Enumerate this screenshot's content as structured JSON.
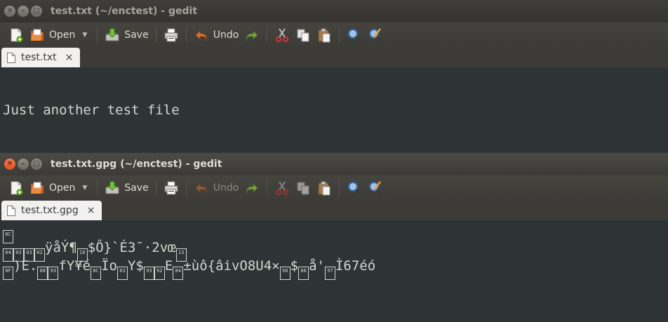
{
  "windows": [
    {
      "title": "test.txt (~/enctest) - gedit",
      "focused": false,
      "toolbar": {
        "open": "Open",
        "save": "Save",
        "undo": "Undo",
        "undo_enabled": true
      },
      "tab": {
        "label": "test.txt",
        "close": "×"
      },
      "content": [
        "Just another test file"
      ]
    },
    {
      "title": "test.txt.gpg (~/enctest) - gedit",
      "focused": true,
      "toolbar": {
        "open": "Open",
        "save": "Save",
        "undo": "Undo",
        "undo_enabled": false
      },
      "tab": {
        "label": "test.txt.gpg",
        "close": "×"
      },
      "content_segments": [
        [
          {
            "hex": "8C"
          }
        ],
        [
          {
            "hex": "04"
          },
          {
            "hex": "03"
          },
          {
            "hex": "03"
          },
          {
            "hex": "02"
          },
          {
            "t": "ÿåÝ¶"
          },
          {
            "hex": "18"
          },
          {
            "t": "$Ô}`É3¯·2vœ"
          },
          {
            "hex": "13"
          }
        ],
        [
          {
            "hex": "8F"
          },
          {
            "t": ")E."
          },
          {
            "hex": "88"
          },
          {
            "hex": "93"
          },
          {
            "t": "fY¥é"
          },
          {
            "hex": "8C"
          },
          {
            "t": "Ïo"
          },
          {
            "hex": "83"
          },
          {
            "t": "Y$"
          },
          {
            "hex": "93"
          },
          {
            "hex": "92"
          },
          {
            "t": "E"
          },
          {
            "hex": "84"
          },
          {
            "t": "±ùô{âivO8U4×"
          },
          {
            "hex": "98"
          },
          {
            "t": "$"
          },
          {
            "hex": "88"
          },
          {
            "t": "å'"
          },
          {
            "hex": "97"
          },
          {
            "t": "Ì67éó"
          }
        ]
      ]
    }
  ],
  "icons": {
    "new": "new-document-icon",
    "open": "open-folder-icon",
    "save": "save-icon",
    "print": "print-icon",
    "undo": "undo-icon",
    "redo": "redo-icon",
    "cut": "cut-icon",
    "copy": "copy-icon",
    "paste": "paste-icon",
    "find": "find-icon",
    "replace": "find-replace-icon"
  },
  "colors": {
    "editor_bg": "#2e3436",
    "editor_fg": "#d3d7cf",
    "close_button": "#e0531e",
    "chrome": "#3c3b37"
  }
}
